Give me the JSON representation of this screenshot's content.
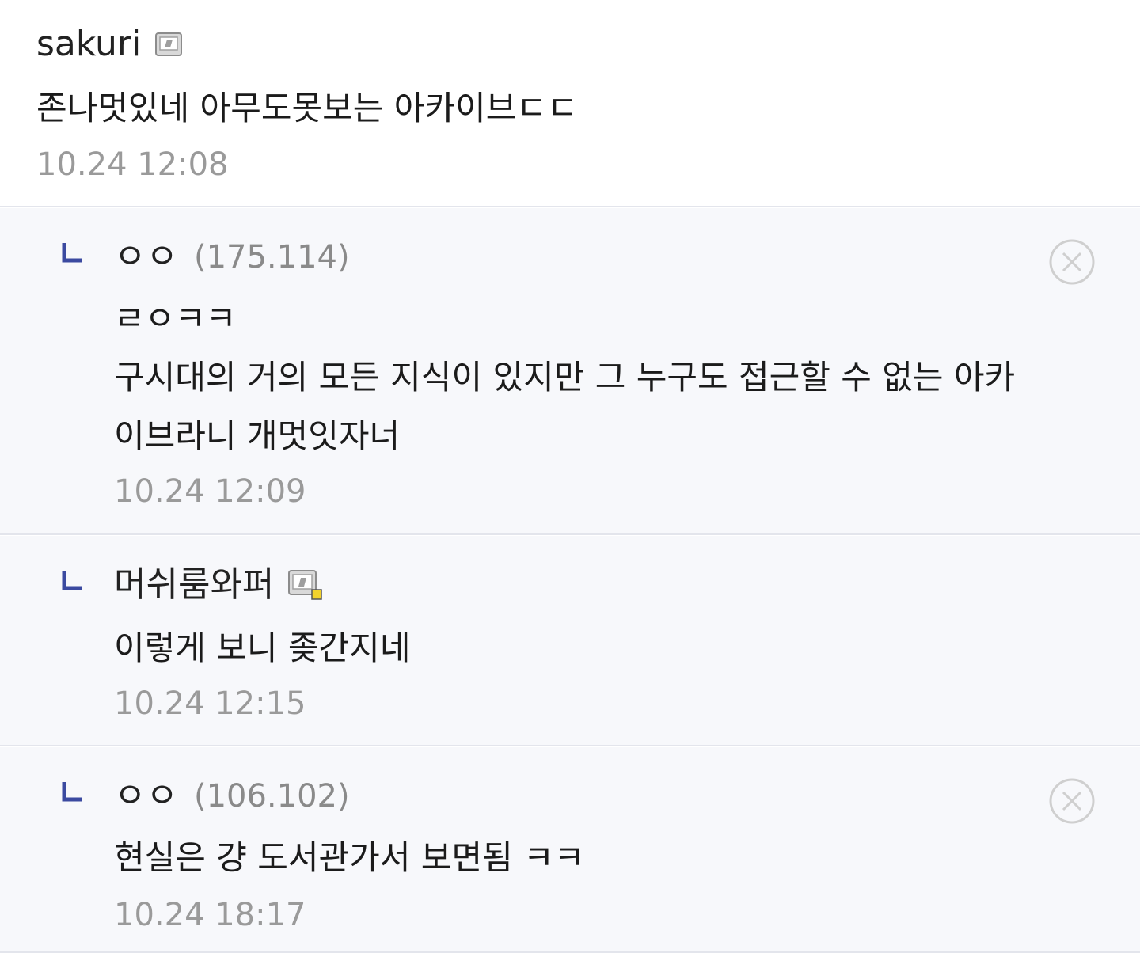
{
  "comments": [
    {
      "nickname": "sakuri",
      "body": "존나멋있네 아무도못보는 아카이브ㄷㄷ",
      "time": "10.24 12:08"
    }
  ],
  "replies": [
    {
      "nickname": "ㅇㅇ",
      "ip": "(175.114)",
      "body_lines": [
        "ㄹㅇㅋㅋ",
        "구시대의 거의 모든 지식이 있지만 그 누구도 접근할 수 없는 아카",
        "이브라니 개멋잇자너"
      ],
      "time": "10.24 12:09"
    },
    {
      "nickname": "머쉬룸와퍼",
      "body_lines": [
        "이렇게 보니 좆간지네"
      ],
      "time": "10.24 12:15"
    },
    {
      "nickname": "ㅇㅇ",
      "ip": "(106.102)",
      "body_lines": [
        "현실은 걍 도서관가서 보면됨 ㅋㅋ"
      ],
      "time": "10.24 18:17"
    }
  ],
  "icons": {
    "gallery_icon": "fixed-nick-gallery-icon",
    "reply_mark": "reply-arrow-icon",
    "delete": "delete-circle-x-icon"
  },
  "colors": {
    "reply_mark": "#3b4aa0",
    "reply_bg": "#f7f8fb",
    "divider": "#e3e5ec",
    "meta_gray": "#9a9a9a"
  }
}
